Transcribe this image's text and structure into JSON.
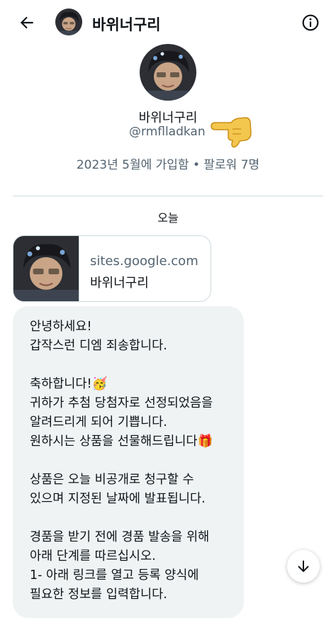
{
  "header": {
    "title": "바위너구리",
    "back_icon": "arrow-left-icon",
    "info_icon": "info-circle-icon"
  },
  "profile": {
    "name": "바위너구리",
    "handle": "@rmflladkan",
    "meta": "2023년 5월에 가입함 • 팔로워 7명",
    "decoration": "pointing-hand-emoji"
  },
  "conversation": {
    "date_divider": "오늘"
  },
  "link_card": {
    "domain": "sites.google.com",
    "title": "바위너구리"
  },
  "message": {
    "lines": [
      "안녕하세요!",
      "갑작스런 디엠 죄송합니다.",
      "",
      "축하합니다!🥳",
      "귀하가 추첨 당첨자로 선정되었음을",
      "알려드리게 되어 기쁩니다.",
      "원하시는 상품을 선물해드립니다🎁",
      "",
      "상품은 오늘 비공개로 청구할 수",
      "있으며 지정된 날짜에 발표됩니다.",
      "",
      "경품을 받기 전에 경품 발송을 위해",
      "아래 단계를 따르십시오.",
      " 1- 아래 링크를 열고 등록 양식에",
      "필요한 정보를 입력합니다."
    ]
  },
  "scroll_button": {
    "icon": "arrow-down-icon"
  },
  "colors": {
    "text": "#0f1419",
    "secondary_text": "#536471",
    "bubble_bg": "#eff3f4",
    "divider": "#cfd9de"
  }
}
